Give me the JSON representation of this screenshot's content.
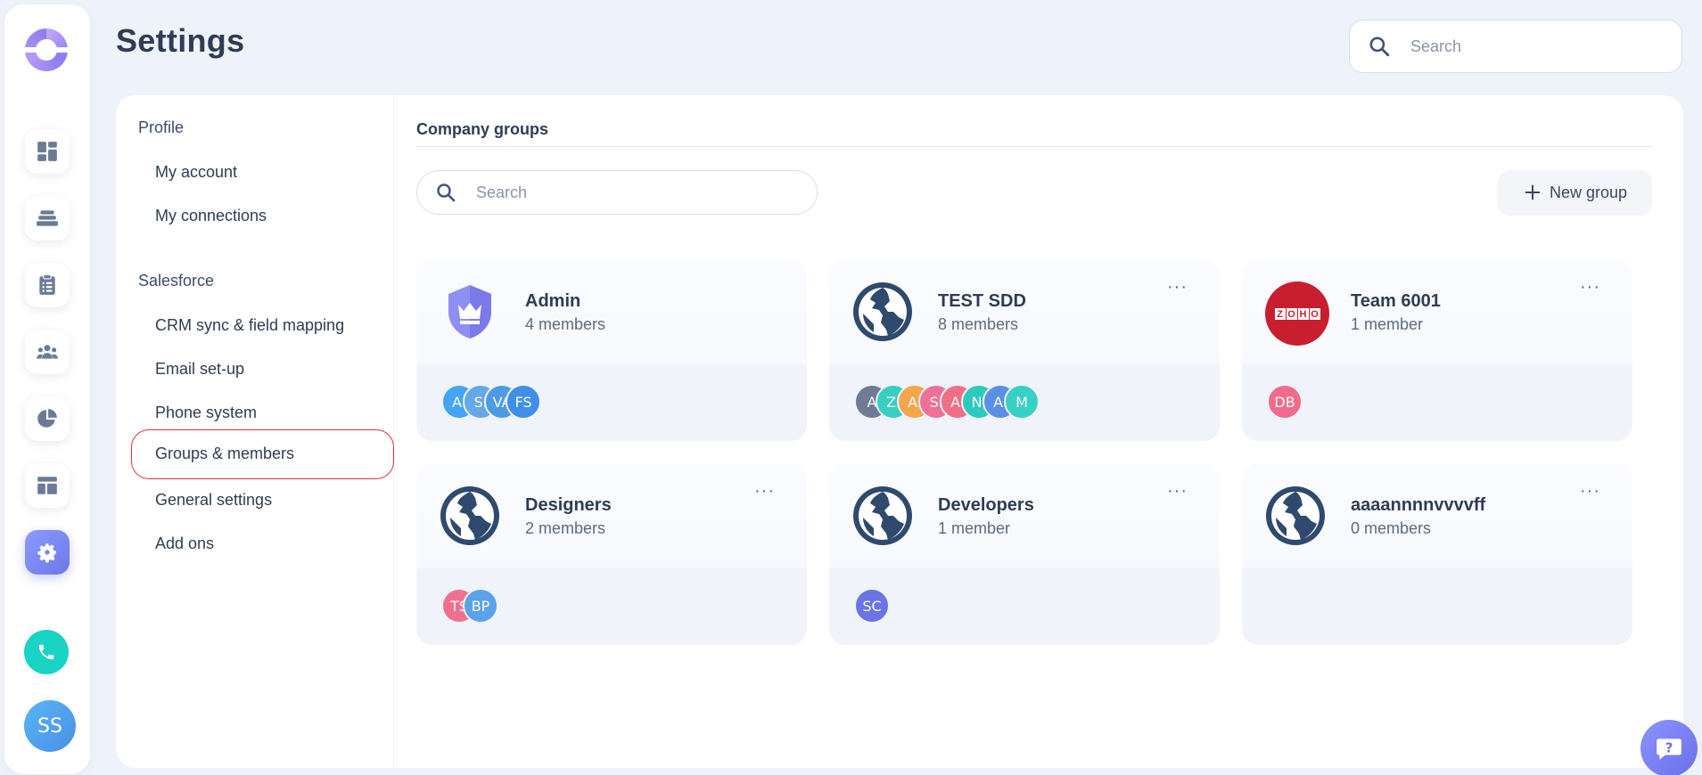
{
  "app": {
    "page_title": "Settings",
    "top_search_placeholder": "Search",
    "user_initials": "SS"
  },
  "rail": {
    "items": [
      {
        "icon": "dashboard-icon"
      },
      {
        "icon": "layers-icon"
      },
      {
        "icon": "clipboard-icon"
      },
      {
        "icon": "team-icon"
      },
      {
        "icon": "pie-chart-icon"
      },
      {
        "icon": "layout-icon"
      },
      {
        "icon": "gear-icon",
        "active": true
      }
    ],
    "phone_icon": "phone-icon"
  },
  "submenu": {
    "sections": [
      {
        "title": "Profile",
        "items": [
          "My account",
          "My connections"
        ]
      },
      {
        "title": "Salesforce",
        "items": [
          "CRM sync & field mapping",
          "Email set-up",
          "Phone system",
          "Groups & members",
          "General settings",
          "Add ons"
        ]
      }
    ],
    "selected": "Groups & members"
  },
  "content": {
    "heading": "Company groups",
    "search_placeholder": "Search",
    "new_group_label": "New group",
    "more_label": "···",
    "groups": [
      {
        "name": "Admin",
        "count": "4 members",
        "icon": "shield-crown-icon",
        "more": false,
        "avatars": [
          {
            "t": "AI",
            "c": "#42a5f5"
          },
          {
            "t": "SI",
            "c": "#64a8e8"
          },
          {
            "t": "VA",
            "c": "#4e9ae6"
          },
          {
            "t": "FS",
            "c": "#3f8fe8"
          }
        ]
      },
      {
        "name": "TEST SDD",
        "count": "8 members",
        "icon": "globe-icon",
        "more": true,
        "avatars": [
          {
            "t": "A",
            "c": "#6f7b94"
          },
          {
            "t": "ZI",
            "c": "#36cfc2"
          },
          {
            "t": "AI",
            "c": "#f5a54a"
          },
          {
            "t": "SI",
            "c": "#f0709a"
          },
          {
            "t": "AI",
            "c": "#f06e86"
          },
          {
            "t": "NI",
            "c": "#2ec9bd"
          },
          {
            "t": "AI",
            "c": "#5a8fe6"
          },
          {
            "t": "M",
            "c": "#39d0c4"
          }
        ]
      },
      {
        "name": "Team 6001",
        "count": "1 member",
        "icon": "zoho-logo",
        "more": true,
        "avatars": [
          {
            "t": "DB",
            "c": "#f26b8a"
          }
        ]
      },
      {
        "name": "Designers",
        "count": "2 members",
        "icon": "globe-icon",
        "more": true,
        "avatars": [
          {
            "t": "TS",
            "c": "#f0708e"
          },
          {
            "t": "BP",
            "c": "#5aa2ea"
          }
        ]
      },
      {
        "name": "Developers",
        "count": "1 member",
        "icon": "globe-icon",
        "more": true,
        "avatars": [
          {
            "t": "SC",
            "c": "#6a74e4"
          }
        ]
      },
      {
        "name": "aaaannnnvvvvff",
        "count": "0 members",
        "icon": "globe-icon",
        "more": true,
        "avatars": []
      }
    ],
    "zoho_letters": [
      "Z",
      "O",
      "H",
      "O"
    ]
  },
  "colors": {
    "accent": "#6d78e8",
    "selected_outline": "#e0323f",
    "globe": "#2f4a6e"
  }
}
